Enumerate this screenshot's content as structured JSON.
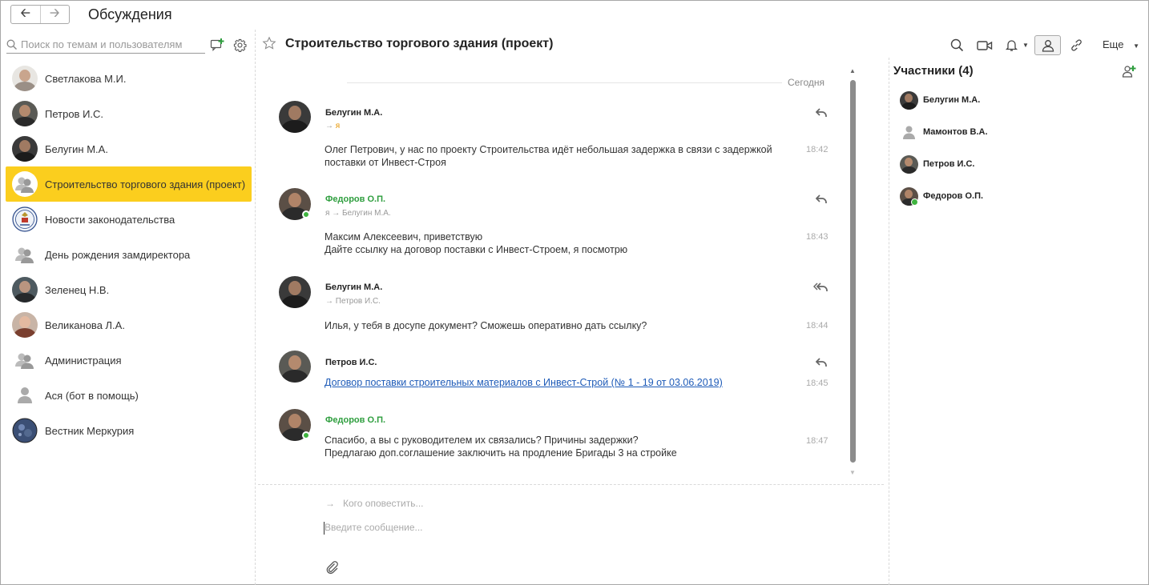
{
  "app": {
    "title": "Обсуждения",
    "back_icon": "arrow-left-icon",
    "forward_icon": "arrow-right-icon"
  },
  "search": {
    "placeholder": "Поиск по темам и пользователям"
  },
  "sidebar": {
    "items": [
      {
        "label": "Светлакова М.И.",
        "avatar": "photo-woman",
        "active": false
      },
      {
        "label": "Петров И.С.",
        "avatar": "photo-man",
        "active": false
      },
      {
        "label": "Белугин М.А.",
        "avatar": "photo-man",
        "active": false
      },
      {
        "label": "Строительство торгового здания (проект)",
        "avatar": "group-icon",
        "active": true
      },
      {
        "label": "Новости законодательства",
        "avatar": "emblem-logo",
        "active": false
      },
      {
        "label": "День рождения замдиректора",
        "avatar": "group-icon",
        "active": false
      },
      {
        "label": "Зеленец Н.В.",
        "avatar": "photo-man",
        "active": false
      },
      {
        "label": "Великанова Л.А.",
        "avatar": "photo-woman",
        "active": false
      },
      {
        "label": "Администрация",
        "avatar": "group-icon",
        "active": false
      },
      {
        "label": "Ася (бот в помощь)",
        "avatar": "user-icon",
        "active": false
      },
      {
        "label": "Вестник Меркурия",
        "avatar": "planet-logo",
        "active": false
      }
    ]
  },
  "chat": {
    "title": "Строительство торгового здания (проект)",
    "more_label": "Еще",
    "date_separator": "Сегодня",
    "messages": [
      {
        "author": "Белугин М.А.",
        "author_color": "#222222",
        "to_prefix": "→",
        "to": "я",
        "text1": "Олег Петрович, у нас по проекту Строительства идёт небольшая задержка в связи с задержкой",
        "text2": "поставки от Инвест-Строя",
        "time": "18:42",
        "online": false
      },
      {
        "author": "Федоров О.П.",
        "author_color": "#2e9e3e",
        "to_prefix": "я →",
        "to": "Белугин М.А.",
        "text1": "Максим Алексеевич, приветствую",
        "text2": "Дайте ссылку на договор поставки с Инвест-Строем, я посмотрю",
        "time": "18:43",
        "online": true
      },
      {
        "author": "Белугин М.А.",
        "author_color": "#222222",
        "to_prefix": "→",
        "to": "Петров И.С.",
        "text1": "Илья, у тебя в досупе документ? Сможешь оперативно дать ссылку?",
        "text2": "",
        "time": "18:44",
        "online": false
      },
      {
        "author": "Петров И.С.",
        "author_color": "#222222",
        "link": "Договор поставки строительных материалов с Инвест-Строй (№ 1 - 19 от 03.06.2019)",
        "time": "18:45",
        "online": false
      },
      {
        "author": "Федоров О.П.",
        "author_color": "#2e9e3e",
        "text1": "Спасибо, а вы с руководителем их связались? Причины задержки?",
        "text2": "Предлагаю доп.соглашение заключить на продление Бригады 3 на стройке",
        "time": "18:47",
        "online": true
      }
    ]
  },
  "composer": {
    "notify_placeholder": "Кого оповестить...",
    "message_placeholder": "Введите сообщение..."
  },
  "members": {
    "title": "Участники (4)",
    "list": [
      {
        "name": "Белугин М.А.",
        "avatar": "photo-man",
        "online": false
      },
      {
        "name": "Мамонтов В.А.",
        "avatar": "user-icon",
        "online": false
      },
      {
        "name": "Петров И.С.",
        "avatar": "photo-man",
        "online": false
      },
      {
        "name": "Федоров О.П.",
        "avatar": "photo-man",
        "online": true
      }
    ]
  },
  "colors": {
    "accent": "#fbce1e",
    "online": "#3fb33f",
    "link": "#1e5bb8",
    "author_green": "#2e9e3e",
    "mention": "#e69500"
  }
}
